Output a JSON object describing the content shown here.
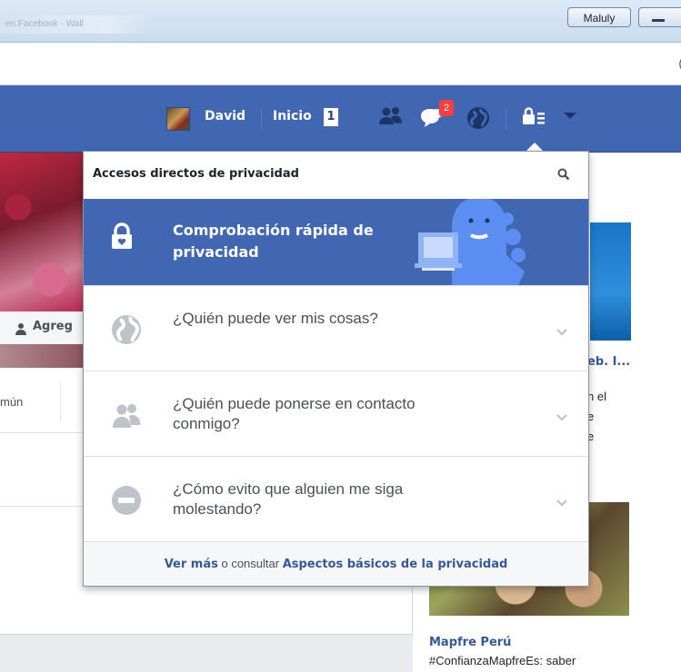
{
  "window": {
    "blurred_tab_text": "en Facebook · Wall",
    "user_chip": "Maluly",
    "address_glyph": "("
  },
  "topbar": {
    "user_name": "David",
    "home_label": "Inicio",
    "home_count": "1",
    "messages_badge": "2",
    "icons": [
      "friends-icon",
      "messages-icon",
      "notifications-globe-icon",
      "privacy-lock-icon",
      "account-caret-icon"
    ]
  },
  "background": {
    "add_friend_label": "Agreg",
    "common_tab_label": "mún",
    "ad_title": "eb. I...",
    "ad_lines": [
      "n el",
      "e",
      "e"
    ],
    "ad2_title": "Mapfre Perú",
    "ad2_text": "#ConfianzaMapfreEs: saber"
  },
  "privacy_menu": {
    "title": "Accesos directos de privacidad",
    "checkup": {
      "title": "Comprobación rápida de privacidad"
    },
    "items": [
      {
        "label": "¿Quién puede ver mis cosas?",
        "icon": "globe-icon"
      },
      {
        "label": "¿Quién puede ponerse en contacto conmigo?",
        "icon": "people-icon"
      },
      {
        "label": "¿Cómo evito que alguien me siga molestando?",
        "icon": "block-icon"
      }
    ],
    "footer": {
      "see_more": "Ver más",
      "connector": " o consultar ",
      "basics_link": "Aspectos básicos de la privacidad"
    }
  },
  "colors": {
    "facebook_blue": "#4267b2",
    "link_blue": "#365899",
    "badge_red": "#fa3e3e",
    "dino_blue": "#5b8ef0"
  }
}
